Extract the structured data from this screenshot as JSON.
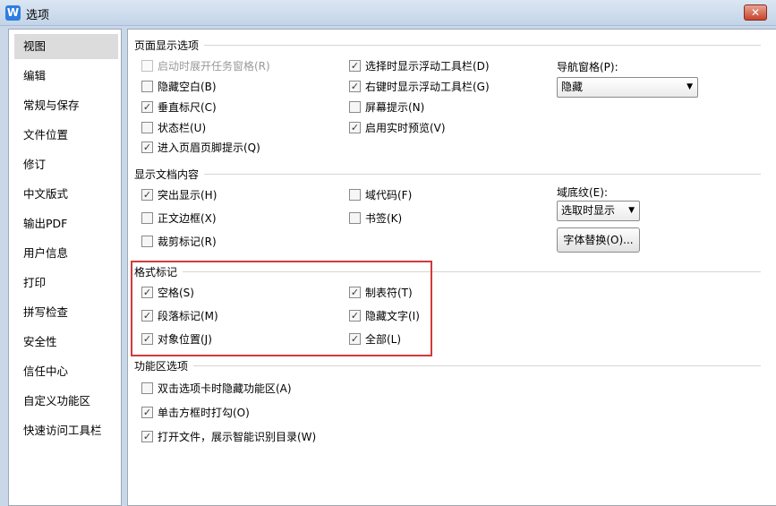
{
  "window": {
    "title": "选项",
    "app_icon": "W",
    "close": "✕"
  },
  "sidebar": {
    "items": [
      "视图",
      "编辑",
      "常规与保存",
      "文件位置",
      "修订",
      "中文版式",
      "输出PDF",
      "用户信息",
      "打印",
      "拼写检查",
      "安全性",
      "信任中心",
      "自定义功能区",
      "快速访问工具栏"
    ],
    "selected": "视图"
  },
  "sections": {
    "page": "页面显示选项",
    "content": "显示文档内容",
    "format": "格式标记",
    "ribbon": "功能区选项"
  },
  "page_options": {
    "startup_taskpane": {
      "label": "启动时展开任务窗格(R)",
      "checked": false,
      "disabled": true
    },
    "hide_whitespace": {
      "label": "隐藏空白(B)",
      "checked": false
    },
    "vertical_ruler": {
      "label": "垂直标尺(C)",
      "checked": true
    },
    "status_bar": {
      "label": "状态栏(U)",
      "checked": false
    },
    "header_footer_hint": {
      "label": "进入页眉页脚提示(Q)",
      "checked": true
    },
    "floating_toolbar_select": {
      "label": "选择时显示浮动工具栏(D)",
      "checked": true
    },
    "floating_toolbar_rightclick": {
      "label": "右键时显示浮动工具栏(G)",
      "checked": true
    },
    "screen_tips": {
      "label": "屏幕提示(N)",
      "checked": false
    },
    "live_preview": {
      "label": "启用实时预览(V)",
      "checked": true
    }
  },
  "nav_pane": {
    "label": "导航窗格(P):",
    "value": "隐藏"
  },
  "content_options": {
    "highlight": {
      "label": "突出显示(H)",
      "checked": true
    },
    "text_boundaries": {
      "label": "正文边框(X)",
      "checked": false
    },
    "crop_marks": {
      "label": "裁剪标记(R)",
      "checked": false
    },
    "field_codes": {
      "label": "域代码(F)",
      "checked": false
    },
    "bookmarks": {
      "label": "书签(K)",
      "checked": false
    }
  },
  "field_shading": {
    "label": "域底纹(E):",
    "value": "选取时显示"
  },
  "font_substitution": {
    "label": "字体替换(O)..."
  },
  "format_marks": {
    "spaces": {
      "label": "空格(S)",
      "checked": true
    },
    "paragraph_marks": {
      "label": "段落标记(M)",
      "checked": true
    },
    "object_anchors": {
      "label": "对象位置(J)",
      "checked": true
    },
    "tab_chars": {
      "label": "制表符(T)",
      "checked": true
    },
    "hidden_text": {
      "label": "隐藏文字(I)",
      "checked": true
    },
    "all": {
      "label": "全部(L)",
      "checked": true
    }
  },
  "ribbon_options": {
    "dblclick_hide": {
      "label": "双击选项卡时隐藏功能区(A)",
      "checked": false
    },
    "click_box_check": {
      "label": "单击方框时打勾(O)",
      "checked": true
    },
    "open_file_toc": {
      "label": "打开文件，展示智能识别目录(W)",
      "checked": true
    }
  },
  "colors": {
    "highlight_border": "#d23a3a",
    "title_bar": "#c9d7e8",
    "sidebar_selected": "#dcdcdc"
  }
}
